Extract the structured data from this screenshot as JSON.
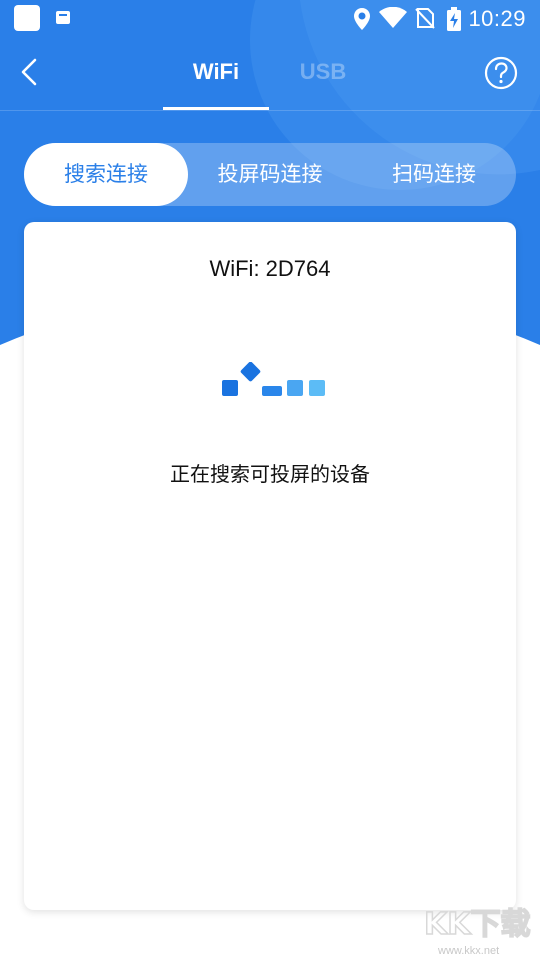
{
  "status_bar": {
    "time": "10:29"
  },
  "app_bar": {
    "tabs": [
      {
        "label": "WiFi",
        "active": true
      },
      {
        "label": "USB",
        "active": false
      }
    ]
  },
  "segmented": {
    "items": [
      {
        "label": "搜索连接",
        "selected": true
      },
      {
        "label": "投屏码连接",
        "selected": false
      },
      {
        "label": "扫码连接",
        "selected": false
      }
    ]
  },
  "card": {
    "wifi_label": "WiFi: 2D764",
    "status_text": "正在搜索可投屏的设备"
  },
  "watermark": {
    "url": "www.kkx.net"
  },
  "colors": {
    "primary_blue": "#2a7fe8",
    "light_blue": "#4a9af0"
  }
}
